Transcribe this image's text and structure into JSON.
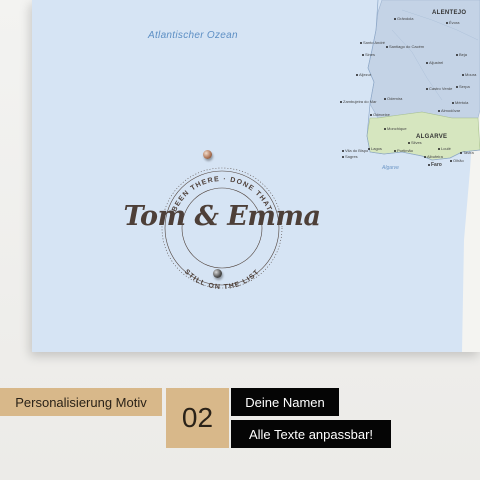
{
  "map": {
    "ocean_label": "Atlantischer Ozean",
    "sea_label": "Algarve",
    "regions": [
      "ALENTEJO",
      "ALGARVE"
    ],
    "cities": [
      "Grândola",
      "Évora",
      "Santo André",
      "Santiago do Cacém",
      "Beja",
      "Sines",
      "Aljustrel",
      "Odemira",
      "Castro Verde",
      "Zambujeira do Mar",
      "Almodôvar",
      "Odeceixe",
      "Monchique",
      "Silves",
      "Loulé",
      "Albufeira",
      "Lagos",
      "Portimão",
      "Faro",
      "Tavira",
      "Sagres",
      "Olhão",
      "Vila do Bispo",
      "Aljezur",
      "Moura",
      "Serpa",
      "Mértola"
    ],
    "colors": {
      "ocean": "#d6e4f4",
      "alentejo": "#c4d3e6",
      "algarve": "#d6e6bf",
      "spain": "#f4f4f1"
    }
  },
  "emblem": {
    "arc_top": "BEEN THERE · DONE THAT",
    "arc_bottom": "STILL ON THE LIST",
    "names": "Tom & Emma"
  },
  "badges": {
    "motiv_label": "Personalisierung Motiv",
    "motiv_number": "02",
    "names_label": "Deine Namen",
    "texts_label": "Alle Texte anpassbar!"
  }
}
